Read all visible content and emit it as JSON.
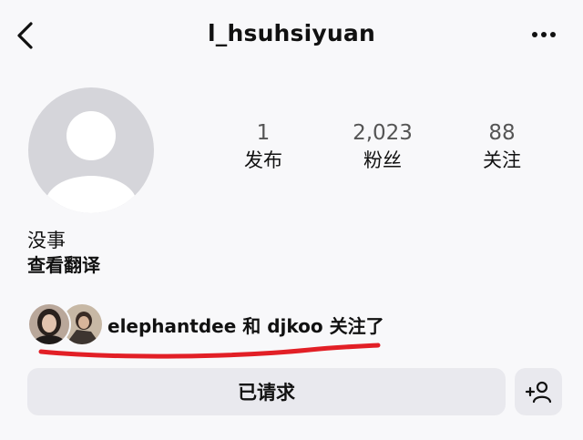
{
  "header": {
    "username": "l_hsuhsiyuan",
    "back_icon": "chevron-left-icon",
    "more_icon": "more-horizontal-icon"
  },
  "profile": {
    "avatar_icon": "default-avatar-icon",
    "stats": [
      {
        "value": "1",
        "label": "发布"
      },
      {
        "value": "2,023",
        "label": "粉丝"
      },
      {
        "value": "88",
        "label": "关注"
      }
    ],
    "bio": "没事",
    "translate_label": "查看翻译"
  },
  "mutual": {
    "text": "elephantdee 和 djkoo 关注了",
    "underline_color": "#e21f26"
  },
  "actions": {
    "requested_label": "已请求",
    "add_user_icon": "add-user-icon"
  }
}
